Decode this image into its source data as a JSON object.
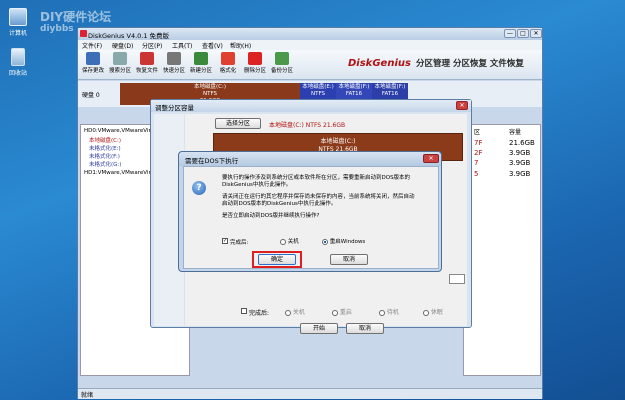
{
  "desktop": {
    "icons": [
      {
        "label": "计算机"
      },
      {
        "label": "回收站"
      }
    ],
    "watermark_title": "DIY硬件论坛",
    "watermark_sub": "diybbs"
  },
  "window": {
    "title": "DiskGenius V4.0.1 免费版",
    "controls": [
      "—",
      "□",
      "✕"
    ],
    "menu": [
      "文件(F)",
      "硬盘(D)",
      "分区(P)",
      "工具(T)",
      "查看(V)",
      "帮助(H)"
    ],
    "toolbar": [
      "保存更改",
      "搜索分区",
      "恢复文件",
      "快速分区",
      "新建分区",
      "格式化",
      "删除分区",
      "备份分区"
    ],
    "banner": {
      "logo": "DiskGenius",
      "slogan": "分区管理 分区恢复 文件恢复"
    },
    "disk_label": "硬盘 0",
    "segments": [
      {
        "name": "本地磁盘(C:)",
        "fs": "NTFS",
        "size": "21.6GB",
        "color": "#8a3a1a"
      },
      {
        "name": "本地磁盘(E:)",
        "fs": "NTFS",
        "size": "",
        "color": "#2b3fb0"
      },
      {
        "name": "本地磁盘(F:)",
        "fs": "FAT16",
        "size": "",
        "color": "#3447b8"
      },
      {
        "name": "本地磁盘(F:)",
        "fs": "FAT16",
        "size": "",
        "color": "#2c3ea8"
      }
    ],
    "tree": [
      "HD0:VMware,VMwareVirtualS",
      "本地磁盘(C:)",
      "未格式化(E:)",
      "未格式化(F:)",
      "未格式化(G:)",
      "HD1:VMware,VMwareVirtualS"
    ],
    "right_table": {
      "headers": [
        "区",
        "容量"
      ],
      "rows": [
        [
          "7F",
          "21.6GB"
        ],
        [
          "2F",
          "3.9GB"
        ],
        [
          "7",
          "3.9GB"
        ],
        [
          "5",
          "3.9GB"
        ]
      ]
    },
    "status": "就绪"
  },
  "resize_dialog": {
    "title": "调整分区容量",
    "select_button": "选择分区",
    "partition_info": "本地磁盘(C:) NTFS 21.6GB",
    "bar_name": "本地磁盘(C:)",
    "bar_size": "NTFS 21.6GB",
    "complete_label": "完成后:",
    "options": [
      "关机",
      "重启",
      "待机",
      "休眠"
    ],
    "start_button": "开始",
    "cancel_button": "取消"
  },
  "dos_dialog": {
    "title": "需要在DOS下执行",
    "message1": "要执行的操作涉及到系统分区或本软件所在分区，需要重新启动到DOS版本的DiskGenius中执行此操作。",
    "message2": "请关闭正在运行的其它程序并保存尚未保存的内容，当前系统将关闭，然后自动启动到DOS版本的DiskGenius中执行此操作。",
    "message3": "是否立即启动到DOS版并继续执行操作?",
    "complete_label": "完成后:",
    "option_shutdown": "关机",
    "option_reboot": "重启Windows",
    "ok": "确定",
    "cancel": "取消"
  }
}
